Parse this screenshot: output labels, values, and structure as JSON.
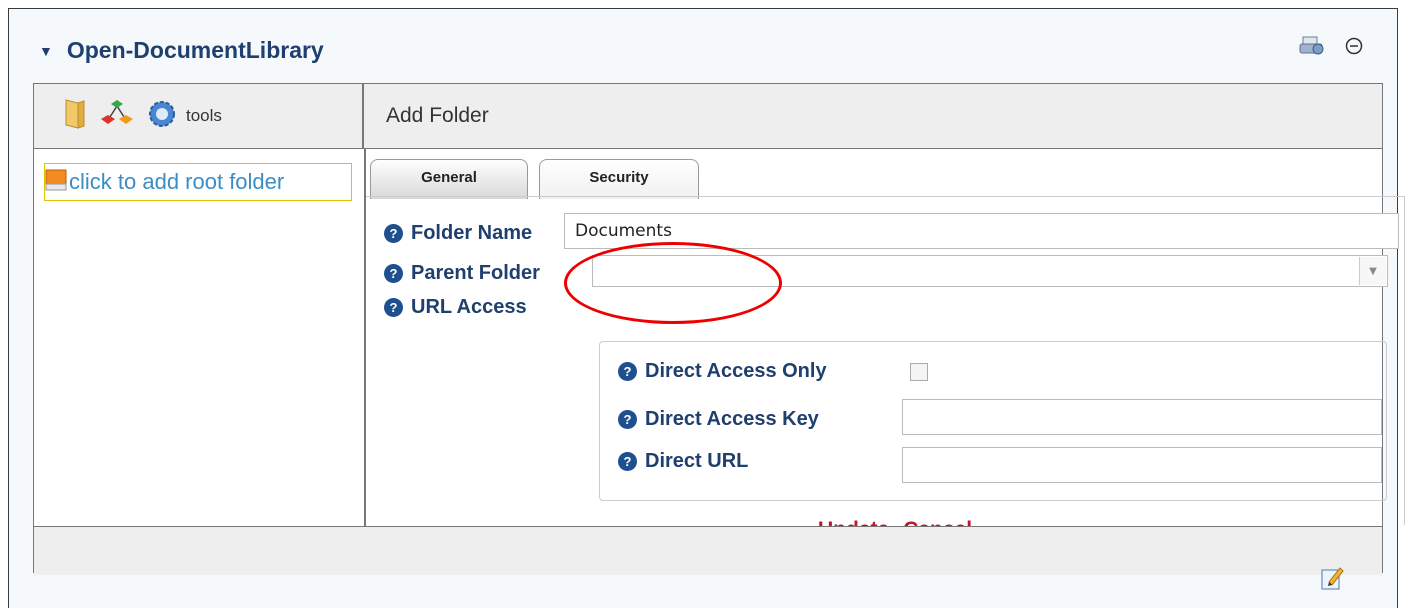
{
  "module": {
    "title": "Open-DocumentLibrary"
  },
  "toolbar": {
    "tools_label": "tools"
  },
  "left_panel": {
    "add_root": "click to add root folder"
  },
  "right_panel": {
    "header": "Add Folder",
    "tabs": [
      {
        "label": "General",
        "active": true
      },
      {
        "label": "Security",
        "active": false
      }
    ]
  },
  "form": {
    "folder_name": {
      "label": "Folder Name",
      "value": "Documents"
    },
    "parent_folder": {
      "label": "Parent Folder",
      "value": ""
    },
    "url_access": {
      "label": "URL Access",
      "direct_access_only": {
        "label": "Direct Access Only",
        "checked": false
      },
      "direct_access_key": {
        "label": "Direct Access Key",
        "value": ""
      },
      "direct_url": {
        "label": "Direct URL",
        "value": ""
      }
    }
  },
  "actions": {
    "update": "Update",
    "cancel": "Cancel"
  },
  "colors": {
    "title": "#1f3f6e",
    "action": "#c8102e",
    "link": "#3a8ec4",
    "highlight": "#e00000"
  },
  "icons": [
    "collapse-triangle-icon",
    "print-icon",
    "minimize-icon",
    "folder-icon",
    "tree-icon",
    "gear-icon",
    "monitor-icon",
    "help-icon",
    "edit-icon"
  ]
}
